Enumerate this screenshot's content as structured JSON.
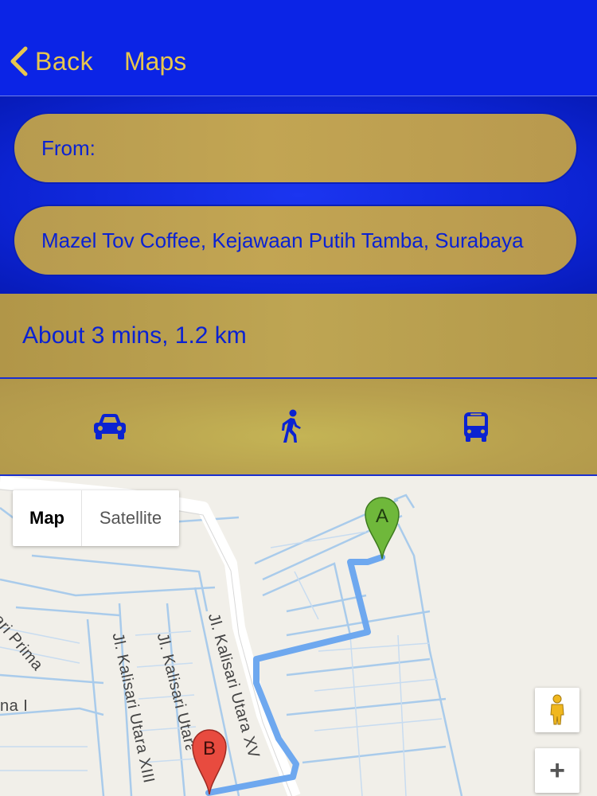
{
  "nav": {
    "back_label": "Back",
    "title": "Maps"
  },
  "route_form": {
    "from_placeholder": "From:",
    "to_value": "Mazel Tov Coffee, Kejawaan Putih Tamba, Surabaya"
  },
  "route_info": {
    "summary": "About 3 mins, 1.2 km"
  },
  "travel_modes": [
    {
      "name": "car",
      "icon": "car-icon"
    },
    {
      "name": "walking",
      "icon": "walking-icon"
    },
    {
      "name": "bus",
      "icon": "bus-icon"
    }
  ],
  "map": {
    "type_buttons": {
      "map": "Map",
      "satellite": "Satellite"
    },
    "street_labels": {
      "street_1": "Jl. Kalisari Utara XV",
      "street_2": "Jl. Kalisari Utara XV",
      "street_3": "Jl. Kalisari Utara XIII",
      "street_4": "ari Prima",
      "street_5": "na I"
    },
    "markers": {
      "start": "A",
      "end": "B"
    },
    "controls": {
      "pegman": "pegman-icon",
      "zoom_in": "+"
    },
    "colors": {
      "route": "#6ea8ef",
      "marker_a": "#6fb83b",
      "marker_b": "#e84b3f"
    }
  },
  "colors": {
    "header_blue": "#0b24e6",
    "accent_gold": "#e7c64e",
    "panel_gold": "#bea553",
    "text_blue": "#0b22d2"
  }
}
